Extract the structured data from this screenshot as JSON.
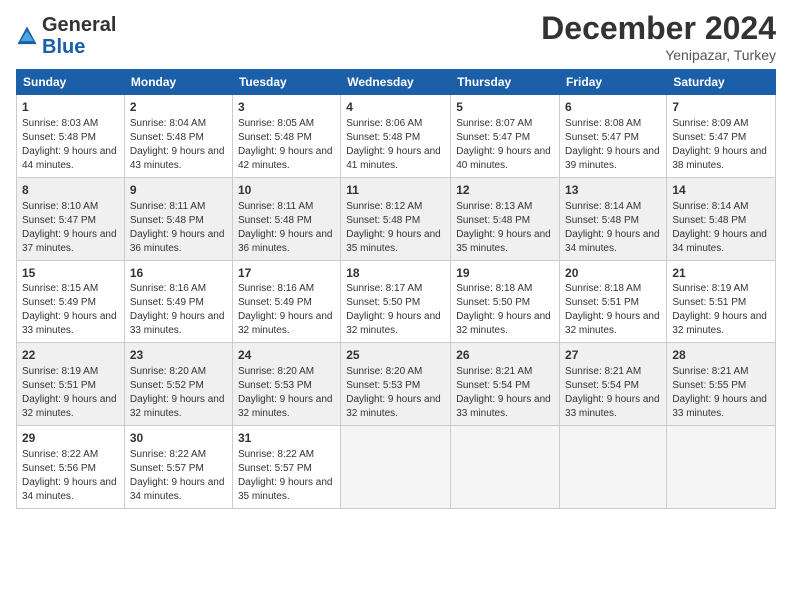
{
  "header": {
    "logo_general": "General",
    "logo_blue": "Blue",
    "month": "December 2024",
    "location": "Yenipazar, Turkey"
  },
  "calendar": {
    "days_of_week": [
      "Sunday",
      "Monday",
      "Tuesday",
      "Wednesday",
      "Thursday",
      "Friday",
      "Saturday"
    ],
    "weeks": [
      [
        {
          "day": "1",
          "sunrise": "Sunrise: 8:03 AM",
          "sunset": "Sunset: 5:48 PM",
          "daylight": "Daylight: 9 hours and 44 minutes."
        },
        {
          "day": "2",
          "sunrise": "Sunrise: 8:04 AM",
          "sunset": "Sunset: 5:48 PM",
          "daylight": "Daylight: 9 hours and 43 minutes."
        },
        {
          "day": "3",
          "sunrise": "Sunrise: 8:05 AM",
          "sunset": "Sunset: 5:48 PM",
          "daylight": "Daylight: 9 hours and 42 minutes."
        },
        {
          "day": "4",
          "sunrise": "Sunrise: 8:06 AM",
          "sunset": "Sunset: 5:48 PM",
          "daylight": "Daylight: 9 hours and 41 minutes."
        },
        {
          "day": "5",
          "sunrise": "Sunrise: 8:07 AM",
          "sunset": "Sunset: 5:47 PM",
          "daylight": "Daylight: 9 hours and 40 minutes."
        },
        {
          "day": "6",
          "sunrise": "Sunrise: 8:08 AM",
          "sunset": "Sunset: 5:47 PM",
          "daylight": "Daylight: 9 hours and 39 minutes."
        },
        {
          "day": "7",
          "sunrise": "Sunrise: 8:09 AM",
          "sunset": "Sunset: 5:47 PM",
          "daylight": "Daylight: 9 hours and 38 minutes."
        }
      ],
      [
        {
          "day": "8",
          "sunrise": "Sunrise: 8:10 AM",
          "sunset": "Sunset: 5:47 PM",
          "daylight": "Daylight: 9 hours and 37 minutes."
        },
        {
          "day": "9",
          "sunrise": "Sunrise: 8:11 AM",
          "sunset": "Sunset: 5:48 PM",
          "daylight": "Daylight: 9 hours and 36 minutes."
        },
        {
          "day": "10",
          "sunrise": "Sunrise: 8:11 AM",
          "sunset": "Sunset: 5:48 PM",
          "daylight": "Daylight: 9 hours and 36 minutes."
        },
        {
          "day": "11",
          "sunrise": "Sunrise: 8:12 AM",
          "sunset": "Sunset: 5:48 PM",
          "daylight": "Daylight: 9 hours and 35 minutes."
        },
        {
          "day": "12",
          "sunrise": "Sunrise: 8:13 AM",
          "sunset": "Sunset: 5:48 PM",
          "daylight": "Daylight: 9 hours and 35 minutes."
        },
        {
          "day": "13",
          "sunrise": "Sunrise: 8:14 AM",
          "sunset": "Sunset: 5:48 PM",
          "daylight": "Daylight: 9 hours and 34 minutes."
        },
        {
          "day": "14",
          "sunrise": "Sunrise: 8:14 AM",
          "sunset": "Sunset: 5:48 PM",
          "daylight": "Daylight: 9 hours and 34 minutes."
        }
      ],
      [
        {
          "day": "15",
          "sunrise": "Sunrise: 8:15 AM",
          "sunset": "Sunset: 5:49 PM",
          "daylight": "Daylight: 9 hours and 33 minutes."
        },
        {
          "day": "16",
          "sunrise": "Sunrise: 8:16 AM",
          "sunset": "Sunset: 5:49 PM",
          "daylight": "Daylight: 9 hours and 33 minutes."
        },
        {
          "day": "17",
          "sunrise": "Sunrise: 8:16 AM",
          "sunset": "Sunset: 5:49 PM",
          "daylight": "Daylight: 9 hours and 32 minutes."
        },
        {
          "day": "18",
          "sunrise": "Sunrise: 8:17 AM",
          "sunset": "Sunset: 5:50 PM",
          "daylight": "Daylight: 9 hours and 32 minutes."
        },
        {
          "day": "19",
          "sunrise": "Sunrise: 8:18 AM",
          "sunset": "Sunset: 5:50 PM",
          "daylight": "Daylight: 9 hours and 32 minutes."
        },
        {
          "day": "20",
          "sunrise": "Sunrise: 8:18 AM",
          "sunset": "Sunset: 5:51 PM",
          "daylight": "Daylight: 9 hours and 32 minutes."
        },
        {
          "day": "21",
          "sunrise": "Sunrise: 8:19 AM",
          "sunset": "Sunset: 5:51 PM",
          "daylight": "Daylight: 9 hours and 32 minutes."
        }
      ],
      [
        {
          "day": "22",
          "sunrise": "Sunrise: 8:19 AM",
          "sunset": "Sunset: 5:51 PM",
          "daylight": "Daylight: 9 hours and 32 minutes."
        },
        {
          "day": "23",
          "sunrise": "Sunrise: 8:20 AM",
          "sunset": "Sunset: 5:52 PM",
          "daylight": "Daylight: 9 hours and 32 minutes."
        },
        {
          "day": "24",
          "sunrise": "Sunrise: 8:20 AM",
          "sunset": "Sunset: 5:53 PM",
          "daylight": "Daylight: 9 hours and 32 minutes."
        },
        {
          "day": "25",
          "sunrise": "Sunrise: 8:20 AM",
          "sunset": "Sunset: 5:53 PM",
          "daylight": "Daylight: 9 hours and 32 minutes."
        },
        {
          "day": "26",
          "sunrise": "Sunrise: 8:21 AM",
          "sunset": "Sunset: 5:54 PM",
          "daylight": "Daylight: 9 hours and 33 minutes."
        },
        {
          "day": "27",
          "sunrise": "Sunrise: 8:21 AM",
          "sunset": "Sunset: 5:54 PM",
          "daylight": "Daylight: 9 hours and 33 minutes."
        },
        {
          "day": "28",
          "sunrise": "Sunrise: 8:21 AM",
          "sunset": "Sunset: 5:55 PM",
          "daylight": "Daylight: 9 hours and 33 minutes."
        }
      ],
      [
        {
          "day": "29",
          "sunrise": "Sunrise: 8:22 AM",
          "sunset": "Sunset: 5:56 PM",
          "daylight": "Daylight: 9 hours and 34 minutes."
        },
        {
          "day": "30",
          "sunrise": "Sunrise: 8:22 AM",
          "sunset": "Sunset: 5:57 PM",
          "daylight": "Daylight: 9 hours and 34 minutes."
        },
        {
          "day": "31",
          "sunrise": "Sunrise: 8:22 AM",
          "sunset": "Sunset: 5:57 PM",
          "daylight": "Daylight: 9 hours and 35 minutes."
        },
        null,
        null,
        null,
        null
      ]
    ]
  }
}
